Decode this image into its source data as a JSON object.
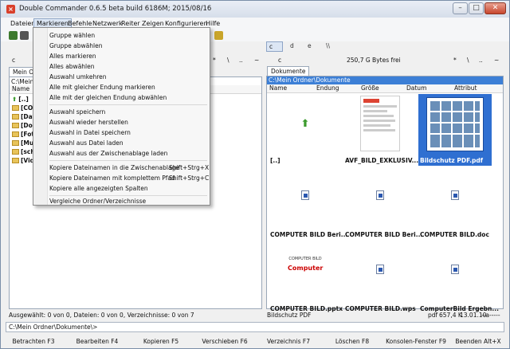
{
  "window": {
    "title": "Double Commander 0.6.5 beta build 6186M; 2015/08/16",
    "minimize": "–",
    "maximize": "□",
    "close": "✕"
  },
  "menu": [
    "Dateien",
    "Markieren",
    "Befehle",
    "Netzwerk",
    "Reiter",
    "Zeigen",
    "Konfigurieren",
    "Hilfe"
  ],
  "markieren_menu": {
    "items": [
      {
        "label": "Gruppe wählen",
        "shortcut": ""
      },
      {
        "label": "Gruppe abwählen",
        "shortcut": ""
      },
      {
        "label": "Alles markieren",
        "shortcut": ""
      },
      {
        "label": "Alles abwählen",
        "shortcut": ""
      },
      {
        "label": "Auswahl umkehren",
        "shortcut": ""
      },
      {
        "label": "Alle mit gleicher Endung markieren",
        "shortcut": ""
      },
      {
        "label": "Alle mit der gleichen Endung abwählen",
        "shortcut": ""
      },
      {
        "label": "Auswahl speichern",
        "shortcut": ""
      },
      {
        "label": "Auswahl wieder herstellen",
        "shortcut": ""
      },
      {
        "label": "Auswahl in Datei speichern",
        "shortcut": ""
      },
      {
        "label": "Auswahl aus Datei laden",
        "shortcut": ""
      },
      {
        "label": "Auswahl aus der Zwischenablage laden",
        "shortcut": ""
      },
      {
        "label": "Kopiere Dateinamen in die Zwischenablage",
        "shortcut": "Shift+Strg+X"
      },
      {
        "label": "Kopiere Dateinamen mit komplettem Pfad",
        "shortcut": "Shift+Strg+C"
      },
      {
        "label": "Kopiere alle angezeigten Spalten",
        "shortcut": ""
      },
      {
        "label": "Vergleiche Ordner/Verzeichnisse",
        "shortcut": ""
      }
    ]
  },
  "left_panel": {
    "drive": "c",
    "tab": "Mein Ord",
    "path": "C:\\Mein O",
    "column_name": "Name",
    "rows": [
      "[..]",
      "[COM",
      "[Dat",
      "[Dok",
      "[Foto",
      "[Mus",
      "[schl",
      "[Vide"
    ],
    "status": "Ausgewählt: 0 von 0, Dateien: 0 von 0, Verzeichnisse: 0 von 7",
    "nav_symbols": [
      "*",
      "\\",
      "..",
      "~"
    ]
  },
  "right_panel": {
    "drive": "c",
    "free_space": "250,7 G Bytes frei",
    "nav_symbols": [
      "*",
      "\\",
      "..",
      "~"
    ],
    "tab": "Dokumente",
    "path": "C:\\Mein Ordner\\Dokumente",
    "columns": [
      "Name",
      "Endung",
      "Größe",
      "Datum",
      "Attribut"
    ],
    "files": [
      {
        "name": "[..]",
        "kind": "up",
        "selected": false
      },
      {
        "name": "AVF_BILD_EXKLUSIV...",
        "kind": "pdf-preview",
        "selected": false
      },
      {
        "name": "Bildschutz PDF.pdf",
        "kind": "photo-grid",
        "selected": true
      },
      {
        "name": "COMPUTER BILD Beri...",
        "kind": "doc",
        "selected": false
      },
      {
        "name": "COMPUTER BILD Beri...",
        "kind": "doc",
        "selected": false
      },
      {
        "name": "COMPUTER BILD.doc",
        "kind": "doc",
        "selected": false
      },
      {
        "name": "COMPUTER BILD.pptx",
        "kind": "logo",
        "selected": false
      },
      {
        "name": "COMPUTER BILD.wps",
        "kind": "doc",
        "selected": false
      },
      {
        "name": "ComputerBild Ergebn...",
        "kind": "doc",
        "selected": false
      }
    ],
    "status_name": "Bildschutz PDF",
    "status_ext": "pdf",
    "status_size": "657,4 K",
    "status_date": "13.01.10",
    "status_attr": "--a-----"
  },
  "thumb_texts": {
    "logo_small": "COMPUTER BILD",
    "logo_big": "Computer"
  },
  "toolbar_drives": [
    {
      "letter": "c",
      "active": true
    },
    {
      "letter": "d",
      "active": false
    },
    {
      "letter": "e",
      "active": false
    },
    {
      "letter": "\\\\",
      "active": false
    }
  ],
  "command_line": "C:\\Mein Ordner\\Dokumente\\>",
  "function_keys": [
    "Betrachten F3",
    "Bearbeiten F4",
    "Kopieren F5",
    "Verschieben F6",
    "Verzeichnis F7",
    "Löschen F8",
    "Konsolen-Fenster F9",
    "Beenden Alt+X"
  ],
  "colors": {
    "accent": "#3c7fd6",
    "selection": "#2f6fd1",
    "menu_highlight": "#dce6f4"
  }
}
